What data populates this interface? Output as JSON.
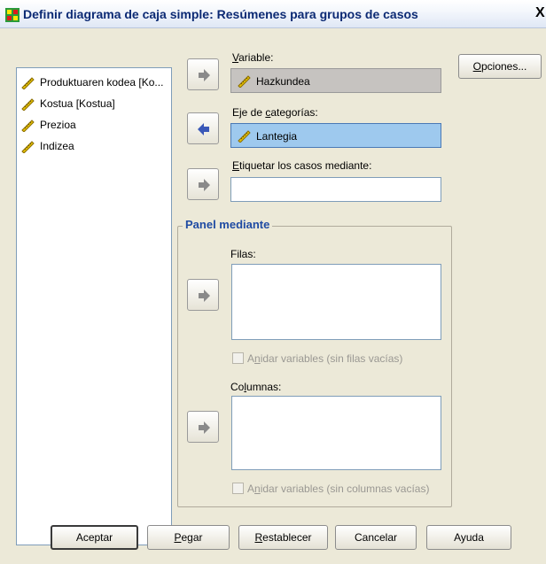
{
  "window": {
    "title": "Definir diagrama de caja simple: Resúmenes para grupos de casos",
    "close_glyph": "X"
  },
  "source_list": {
    "items": [
      {
        "label": "Produktuaren kodea [Ko...",
        "icon": "scale-ruler-icon"
      },
      {
        "label": "Kostua [Kostua]",
        "icon": "scale-ruler-icon"
      },
      {
        "label": "Prezioa",
        "icon": "scale-ruler-icon"
      },
      {
        "label": "Indizea",
        "icon": "scale-ruler-icon"
      }
    ]
  },
  "variable": {
    "label_prefix": "",
    "label_mnemonic": "V",
    "label_rest": "ariable:",
    "value": "Hazkundea"
  },
  "category_axis": {
    "label_a": "Eje de ",
    "label_mnemonic": "c",
    "label_rest": "ategorías:",
    "value": "Lantegia"
  },
  "case_labels": {
    "label_mnemonic": "E",
    "label_rest": "tiquetar los casos mediante:",
    "value": ""
  },
  "panel": {
    "title": "Panel mediante",
    "rows_label": "Filas:",
    "rows_nest_a": "A",
    "rows_nest_mn": "n",
    "rows_nest_rest": "idar variables (sin filas vacías)",
    "cols_label_a": "Co",
    "cols_label_mn": "l",
    "cols_label_rest": "umnas:",
    "cols_nest_a": "A",
    "cols_nest_mn": "n",
    "cols_nest_rest": "idar variables (sin columnas vacías)"
  },
  "buttons": {
    "options_mn": "O",
    "options_rest": "pciones...",
    "ok": "Aceptar",
    "paste_mn": "P",
    "paste_rest": "egar",
    "reset_mn": "R",
    "reset_rest": "establecer",
    "cancel": "Cancelar",
    "help": "Ayuda"
  },
  "colors": {
    "dialog_bg": "#ece9d8",
    "selected_field": "#9ec9ee",
    "panel_title": "#1f4ba3",
    "arrow_active": "#3a58b8",
    "arrow_inactive": "#8a8a8a"
  }
}
